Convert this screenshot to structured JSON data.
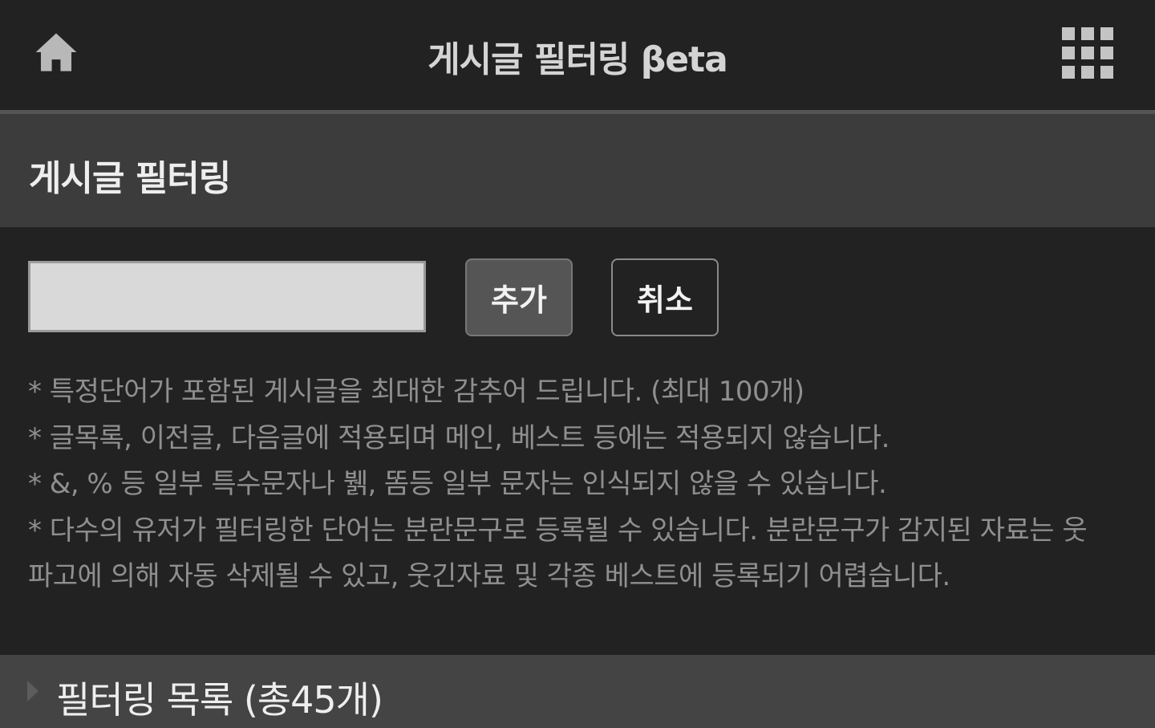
{
  "header": {
    "title": "게시글 필터링 βeta",
    "home_icon": "home-icon",
    "menu_icon": "grid-menu-icon"
  },
  "section": {
    "title": "게시글 필터링"
  },
  "form": {
    "input_value": "",
    "add_label": "추가",
    "cancel_label": "취소"
  },
  "notices": [
    "* 특정단어가 포함된 게시글을 최대한 감추어 드립니다. (최대 100개)",
    "* 글목록, 이전글, 다음글에 적용되며 메인, 베스트 등에는 적용되지 않습니다.",
    "* &, % 등 일부 특수문자나 뷁, 똠등 일부 문자는 인식되지 않을 수 있습니다.",
    "* 다수의 유저가 필터링한 단어는 분란문구로 등록될 수 있습니다. 분란문구가 감지된 자료는 웃",
    "파고에 의해 자동 삭제될 수 있고, 웃긴자료 및 각종 베스트에 등록되기 어렵습니다."
  ],
  "filter_list": {
    "title": "필터링 목록 (총45개)"
  },
  "colors": {
    "background": "#222222",
    "section_bg": "#3c3c3c",
    "input_bg": "#d9d9d9",
    "notice_text": "#8f8f8f"
  }
}
